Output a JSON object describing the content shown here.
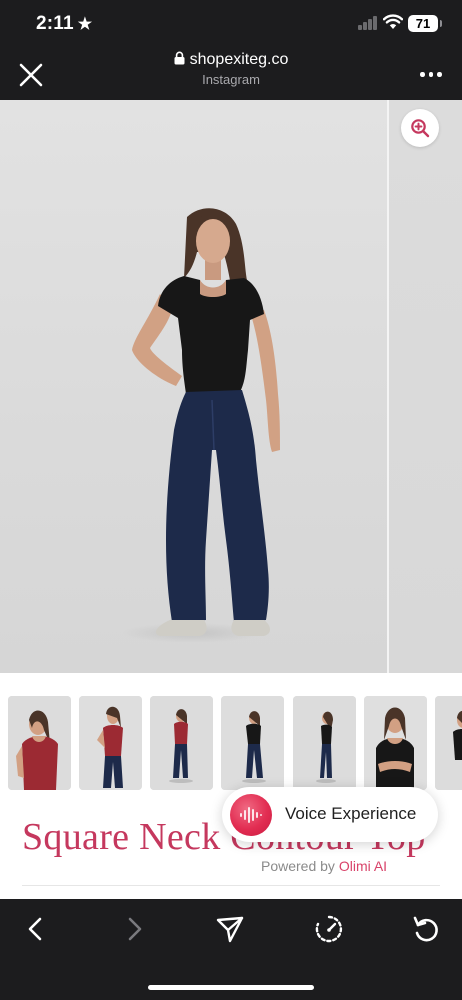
{
  "status_bar": {
    "time": "2:11",
    "battery": "71"
  },
  "browser": {
    "url": "shopexiteg.co",
    "source": "Instagram"
  },
  "gallery": {
    "main_image": "Model wearing black square neck top and dark wide-leg jeans",
    "thumbnails": [
      "Red top front view",
      "Red top with jeans",
      "Red top full body",
      "Black top full body",
      "Black top side view",
      "Black top close-up",
      "More"
    ]
  },
  "product": {
    "title": "Square Neck Contour Top"
  },
  "voice_widget": {
    "label": "Voice Experience",
    "powered_prefix": "Powered by",
    "powered_brand": "Olimi AI"
  },
  "toolbar": {
    "items": [
      "back-icon",
      "forward-icon",
      "share-icon",
      "speed-icon",
      "reload-icon"
    ]
  },
  "colors": {
    "accent": "#c5385e",
    "orb": "#e22d52",
    "chrome": "#1c1c1e"
  }
}
